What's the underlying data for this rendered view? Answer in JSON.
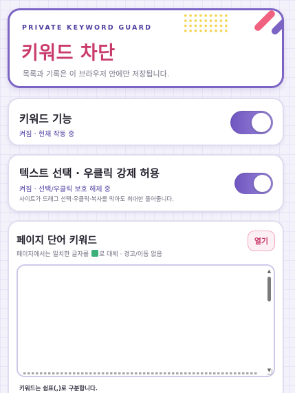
{
  "header": {
    "eyebrow": "PRIVATE KEYWORD GUARD",
    "title": "키워드 차단",
    "subtitle": "목록과 기록은 이 브라우저 안에만 저장됩니다."
  },
  "keyword_feature": {
    "title": "키워드 기능",
    "status": "켜짐 · 현재 작동 중",
    "enabled": true
  },
  "text_select": {
    "title": "텍스트 선택 · 우클릭 강제 허용",
    "status": "켜짐 · 선택/우클릭 보호 해제 중",
    "note": "사이트가 드래그 선택·우클릭·복사를 막아도 최대한 풀어줍니다.",
    "enabled": true
  },
  "page_keywords": {
    "title": "페이지 단어 키워드",
    "desc_before": "페이지에서는 일치한 글자를",
    "desc_after": "로 대체 · 경고/이동 없음",
    "open_label": "열기",
    "textarea_value": "",
    "hint": "키워드는 쉼표(,)로 구분합니다."
  },
  "colors": {
    "accent": "#7b64c4",
    "title_pink": "#c93b6c",
    "replace_square": "#3bb07a"
  }
}
